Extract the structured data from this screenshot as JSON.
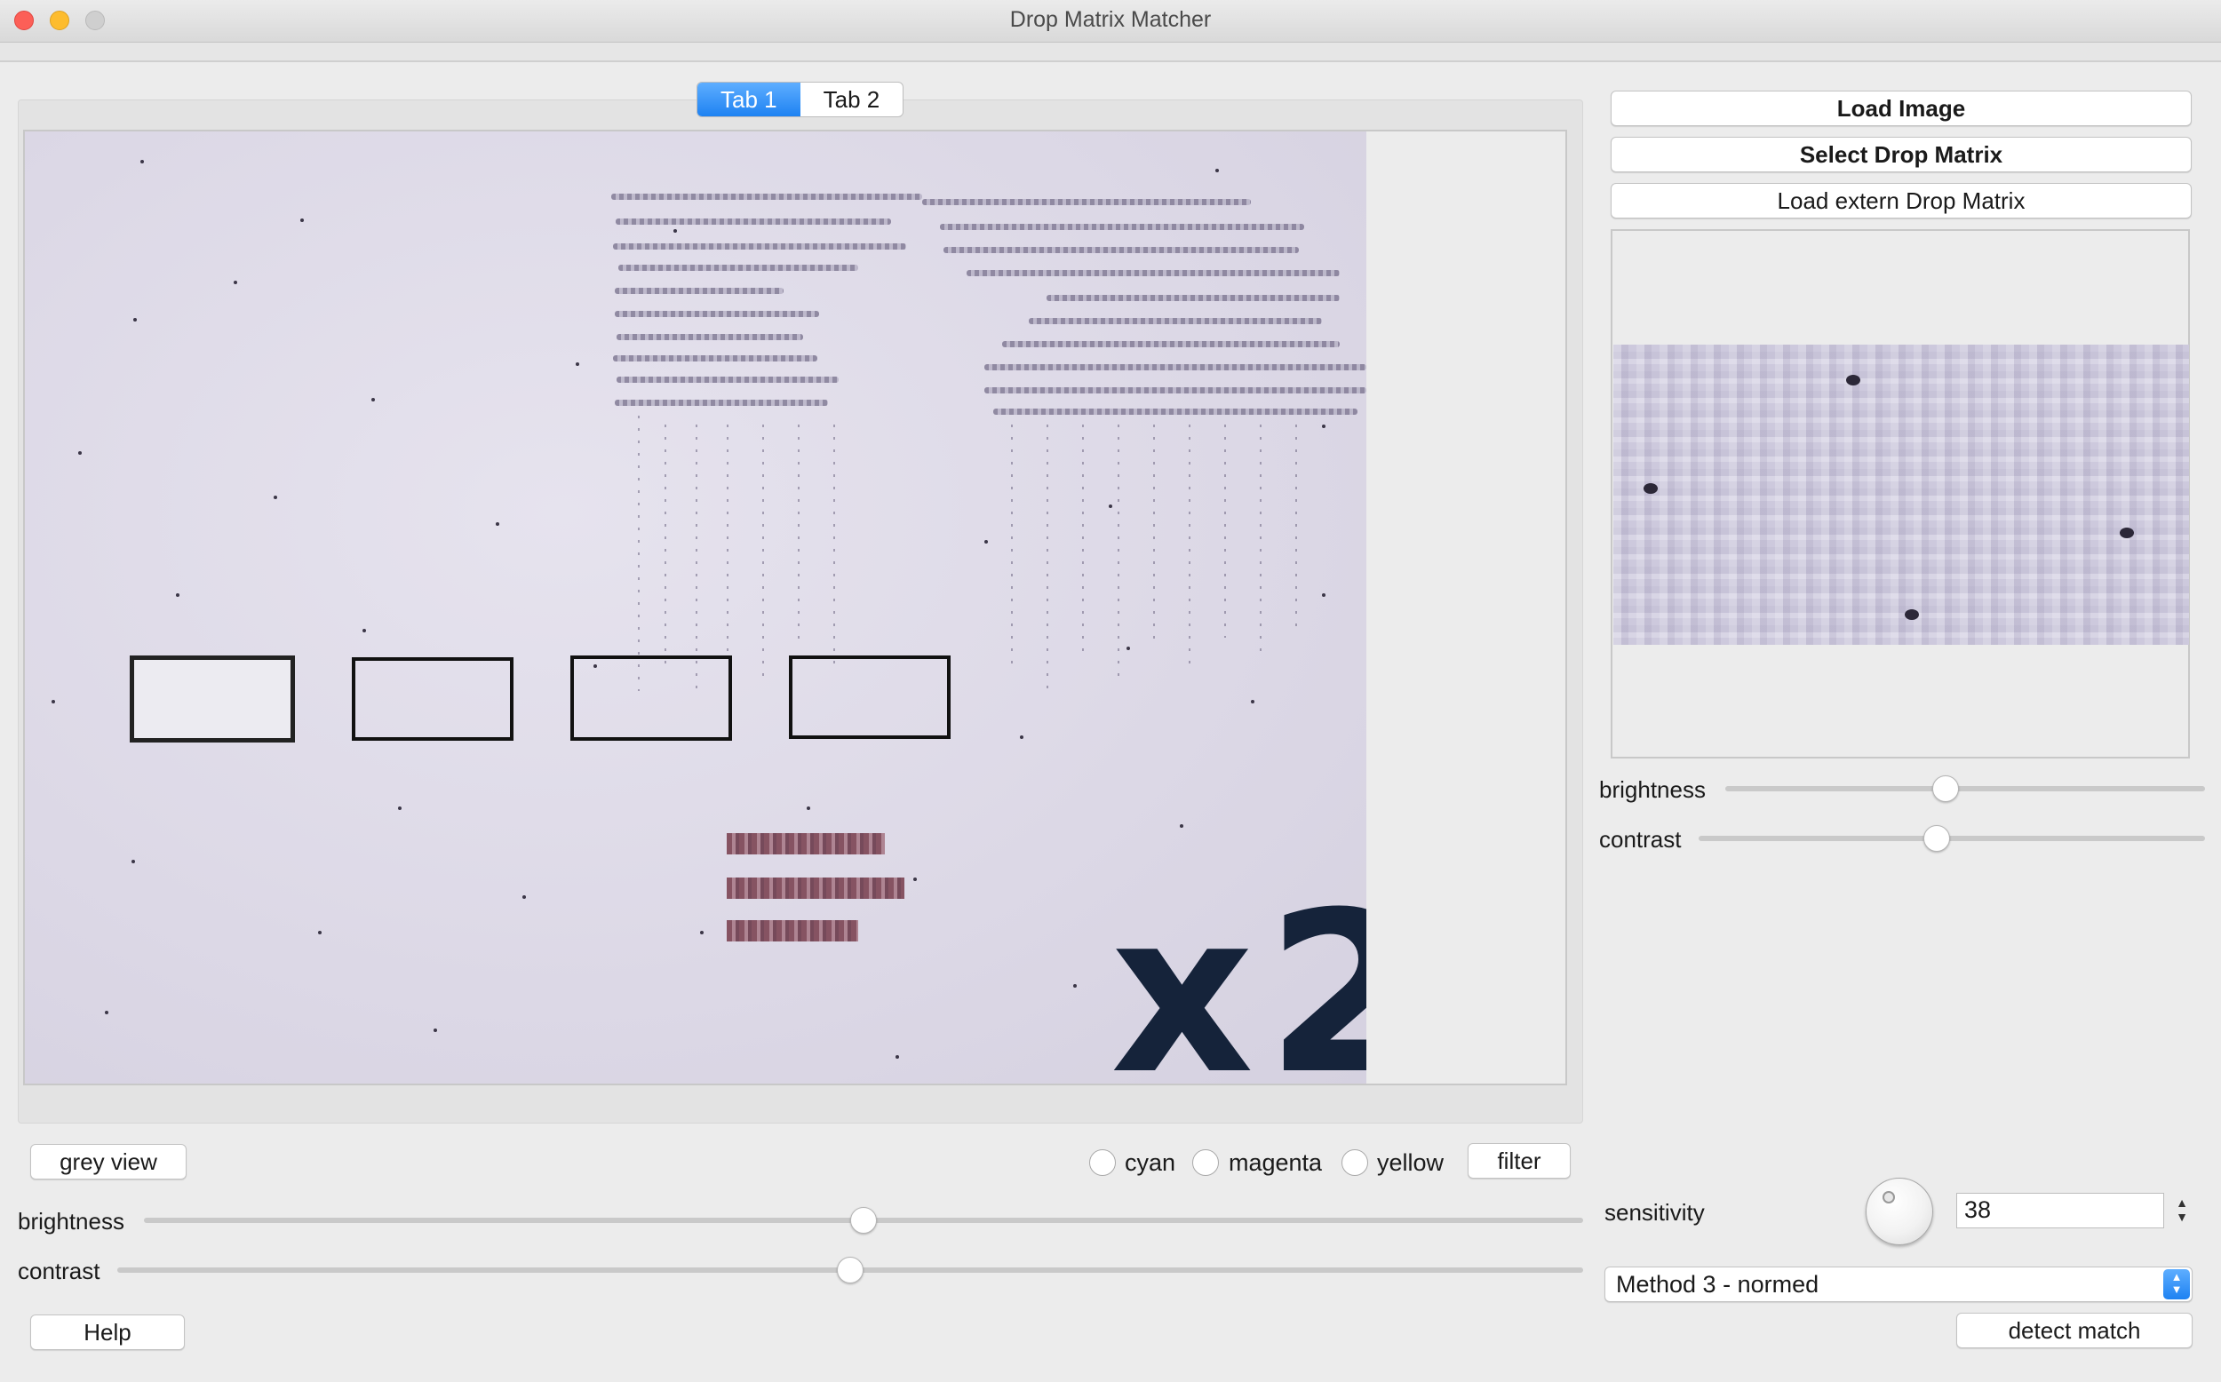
{
  "window": {
    "title": "Drop Matrix Matcher"
  },
  "tabs": [
    {
      "label": "Tab 1",
      "active": true
    },
    {
      "label": "Tab 2",
      "active": false
    }
  ],
  "canvas": {
    "overlay_text": "x2"
  },
  "right_panel": {
    "load_image_label": "Load Image",
    "select_drop_matrix_label": "Select Drop Matrix",
    "load_extern_label": "Load extern Drop Matrix",
    "brightness_label": "brightness",
    "contrast_label": "contrast",
    "brightness_level": 0.46,
    "contrast_level": 0.47,
    "sensitivity_label": "sensitivity",
    "sensitivity_value": "38",
    "method_selected": "Method 3 - normed",
    "detect_match_label": "detect match"
  },
  "bottom_panel": {
    "grey_view_label": "grey view",
    "radio_options": [
      "cyan",
      "magenta",
      "yellow"
    ],
    "filter_label": "filter",
    "brightness_label": "brightness",
    "contrast_label": "contrast",
    "brightness_level": 0.5,
    "contrast_level": 0.5,
    "help_label": "Help"
  },
  "colors": {
    "accent": "#1e82f2",
    "close": "#fc5f57",
    "minimize": "#fdbc2e"
  }
}
